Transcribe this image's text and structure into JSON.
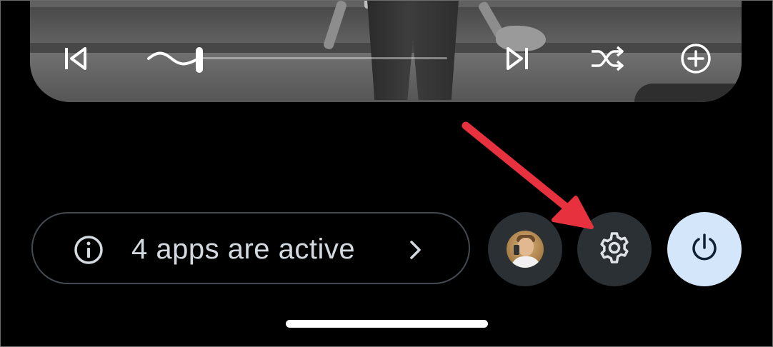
{
  "media": {
    "controls": {
      "previous_icon": "skip-previous-icon",
      "next_icon": "skip-next-icon",
      "shuffle_icon": "shuffle-icon",
      "add_icon": "add-circle-icon",
      "seek_progress": 0.17
    }
  },
  "quick_settings": {
    "active_apps_label": "4 apps are active",
    "info_icon": "info-icon",
    "chevron_icon": "chevron-right-icon",
    "avatar_icon": "user-avatar",
    "settings_icon": "gear-icon",
    "power_icon": "power-icon"
  },
  "annotation": {
    "arrow_color": "#e8313e"
  },
  "colors": {
    "background": "#000000",
    "button_bg": "#2b3034",
    "power_bg": "#d4e6fa",
    "text": "#d5dae0"
  }
}
